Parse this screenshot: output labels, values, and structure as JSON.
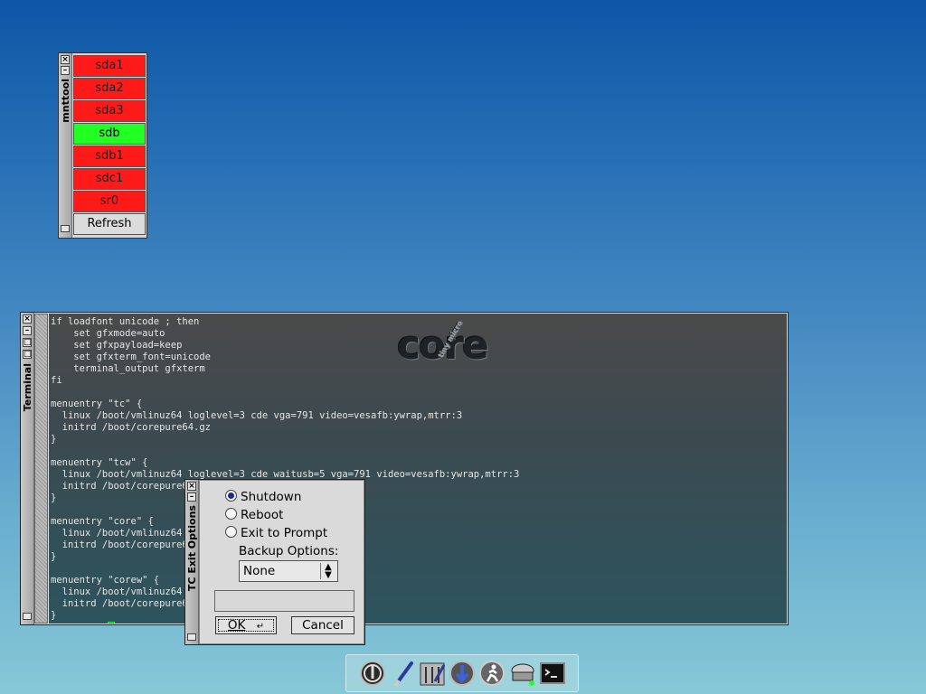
{
  "mnttool": {
    "title": "mnttool",
    "devices": [
      {
        "label": "sda1",
        "status": "unmounted"
      },
      {
        "label": "sda2",
        "status": "unmounted"
      },
      {
        "label": "sda3",
        "status": "unmounted"
      },
      {
        "label": "sdb",
        "status": "mounted"
      },
      {
        "label": "sdb1",
        "status": "unmounted"
      },
      {
        "label": "sdc1",
        "status": "unmounted"
      },
      {
        "label": "sr0",
        "status": "unmounted"
      }
    ],
    "refresh_label": "Refresh",
    "colors": {
      "unmounted": "#ff1a1a",
      "mounted": "#22ff22"
    }
  },
  "terminal": {
    "title": "Terminal",
    "logo_text": "core",
    "logo_subtext": "tiny micro",
    "lines": [
      "if loadfont unicode ; then",
      "    set gfxmode=auto",
      "    set gfxpayload=keep",
      "    set gfxterm_font=unicode",
      "    terminal_output gfxterm",
      "fi",
      "",
      "menuentry \"tc\" {",
      "  linux /boot/vmlinuz64 loglevel=3 cde vga=791 video=vesafb:ywrap,mtrr:3",
      "  initrd /boot/corepure64.gz",
      "}",
      "",
      "menuentry \"tcw\" {",
      "  linux /boot/vmlinuz64 loglevel=3 cde waitusb=5 vga=791 video=vesafb:ywrap,mtrr:3",
      "  initrd /boot/corepure64.gz",
      "}",
      "",
      "menuentry \"core\" {",
      "  linux /boot/vmlinuz64 loglevel=3",
      "  initrd /boot/corepure64.gz",
      "}",
      "",
      "menuentry \"corew\" {",
      "  linux /boot/vmlinuz64 loglevel=3",
      "  initrd /boot/corepure64.gz",
      "}"
    ],
    "prompt": "tc@box:~$ "
  },
  "exit_dialog": {
    "title": "TC Exit Options",
    "options": [
      {
        "label": "Shutdown",
        "selected": true
      },
      {
        "label": "Reboot",
        "selected": false
      },
      {
        "label": "Exit to Prompt",
        "selected": false
      }
    ],
    "backup_label": "Backup Options:",
    "backup_value": "None",
    "text_value": "",
    "ok_label": "OK",
    "cancel_label": "Cancel"
  },
  "taskbar": {
    "icons": [
      "power-icon",
      "paint-brush-icon",
      "control-panel-icon",
      "apps-installer-icon",
      "run-icon",
      "mount-tool-icon",
      "terminal-icon"
    ]
  }
}
